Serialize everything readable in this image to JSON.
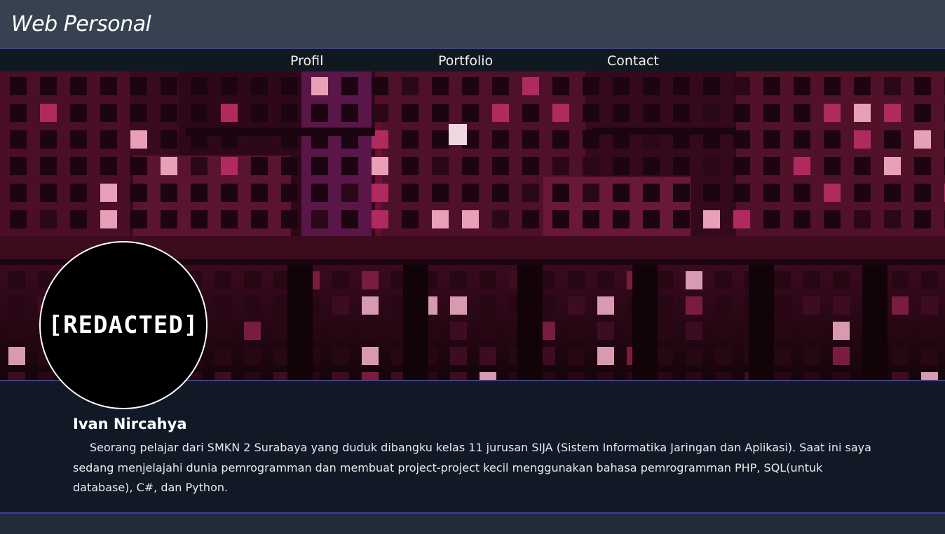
{
  "header": {
    "title": "Web Personal"
  },
  "nav": {
    "items": [
      {
        "label": "Profil"
      },
      {
        "label": "Portfolio"
      },
      {
        "label": "Contact"
      }
    ]
  },
  "banner": {
    "image": "pixel-art neon city buildings at night"
  },
  "profile": {
    "avatar_text": "[REDACTED]",
    "name": "Ivan Nircahya",
    "bio": "Seorang pelajar dari SMKN 2 Surabaya yang duduk dibangku kelas 11 jurusan SIJA (Sistem Informatika Jaringan dan Aplikasi). Saat ini saya sedang menjelajahi dunia pemrogramman dan membuat project-project kecil menggunakan bahasa pemrogramman PHP, SQL(untuk database), C#, dan Python."
  },
  "colors": {
    "header_bg": "#364250",
    "nav_bg": "#101820",
    "content_bg": "#111826",
    "accent_border": "#3a3fa0"
  }
}
